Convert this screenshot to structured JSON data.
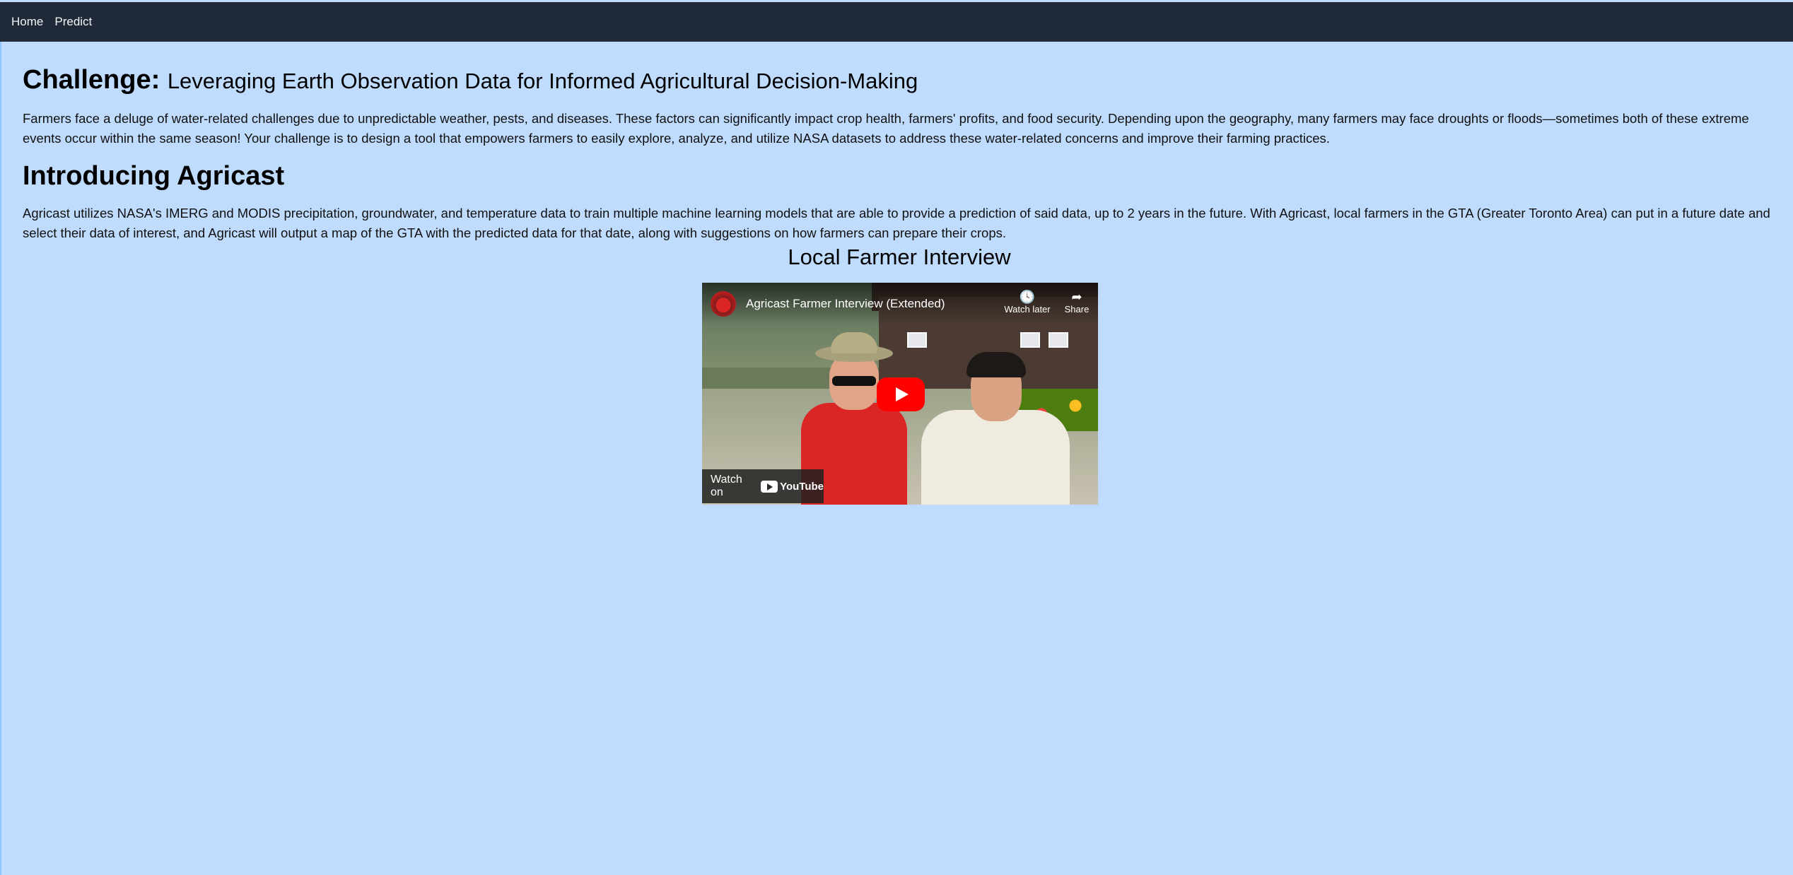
{
  "nav": {
    "items": [
      {
        "label": "Home"
      },
      {
        "label": "Predict"
      }
    ]
  },
  "challenge": {
    "heading": "Challenge:",
    "subtitle": "Leveraging Earth Observation Data for Informed Agricultural Decision-Making",
    "body": "Farmers face a deluge of water-related challenges due to unpredictable weather, pests, and diseases. These factors can significantly impact crop health, farmers' profits, and food security. Depending upon the geography, many farmers may face droughts or floods—sometimes both of these extreme events occur within the same season! Your challenge is to design a tool that empowers farmers to easily explore, analyze, and utilize NASA datasets to address these water-related concerns and improve their farming practices."
  },
  "intro": {
    "heading": "Introducing Agricast",
    "body": "Agricast utilizes NASA's IMERG and MODIS precipitation, groundwater, and temperature data to train multiple machine learning models that are able to provide a prediction of said data, up to 2 years in the future. With Agricast, local farmers in the GTA (Greater Toronto Area) can put in a future date and select their data of interest, and Agricast will output a map of the GTA with the predicted data for that date, along with suggestions on how farmers can prepare their crops."
  },
  "interview": {
    "heading": "Local Farmer Interview",
    "video": {
      "title": "Agricast Farmer Interview (Extended)",
      "watch_later": "Watch later",
      "share": "Share",
      "watch_on": "Watch on",
      "platform": "YouTube",
      "icons": {
        "watch_later": "clock-icon",
        "share": "share-icon",
        "play": "play-icon"
      }
    }
  },
  "colors": {
    "page_bg": "#bfdbfe",
    "navbar_bg": "#1f2937",
    "play_button": "#ff0000"
  }
}
